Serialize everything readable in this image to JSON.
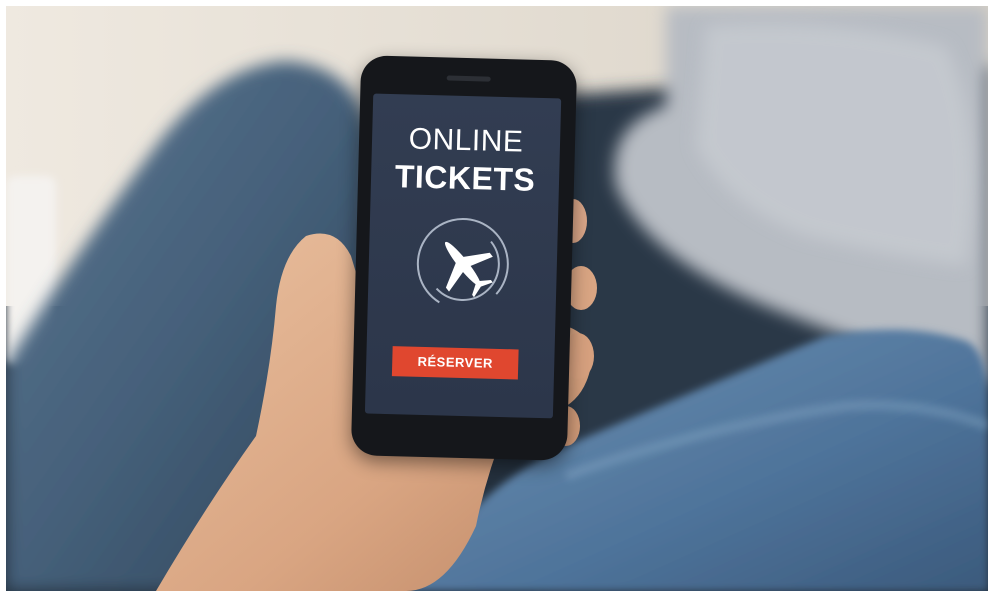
{
  "screen": {
    "title_line1": "ONLINE",
    "title_line2": "TICKETS",
    "icon": "airplane-icon",
    "button_label": "RÉSERVER"
  },
  "colors": {
    "screen_bg": "#2c364a",
    "button": "#e0472f",
    "text": "#ffffff"
  }
}
